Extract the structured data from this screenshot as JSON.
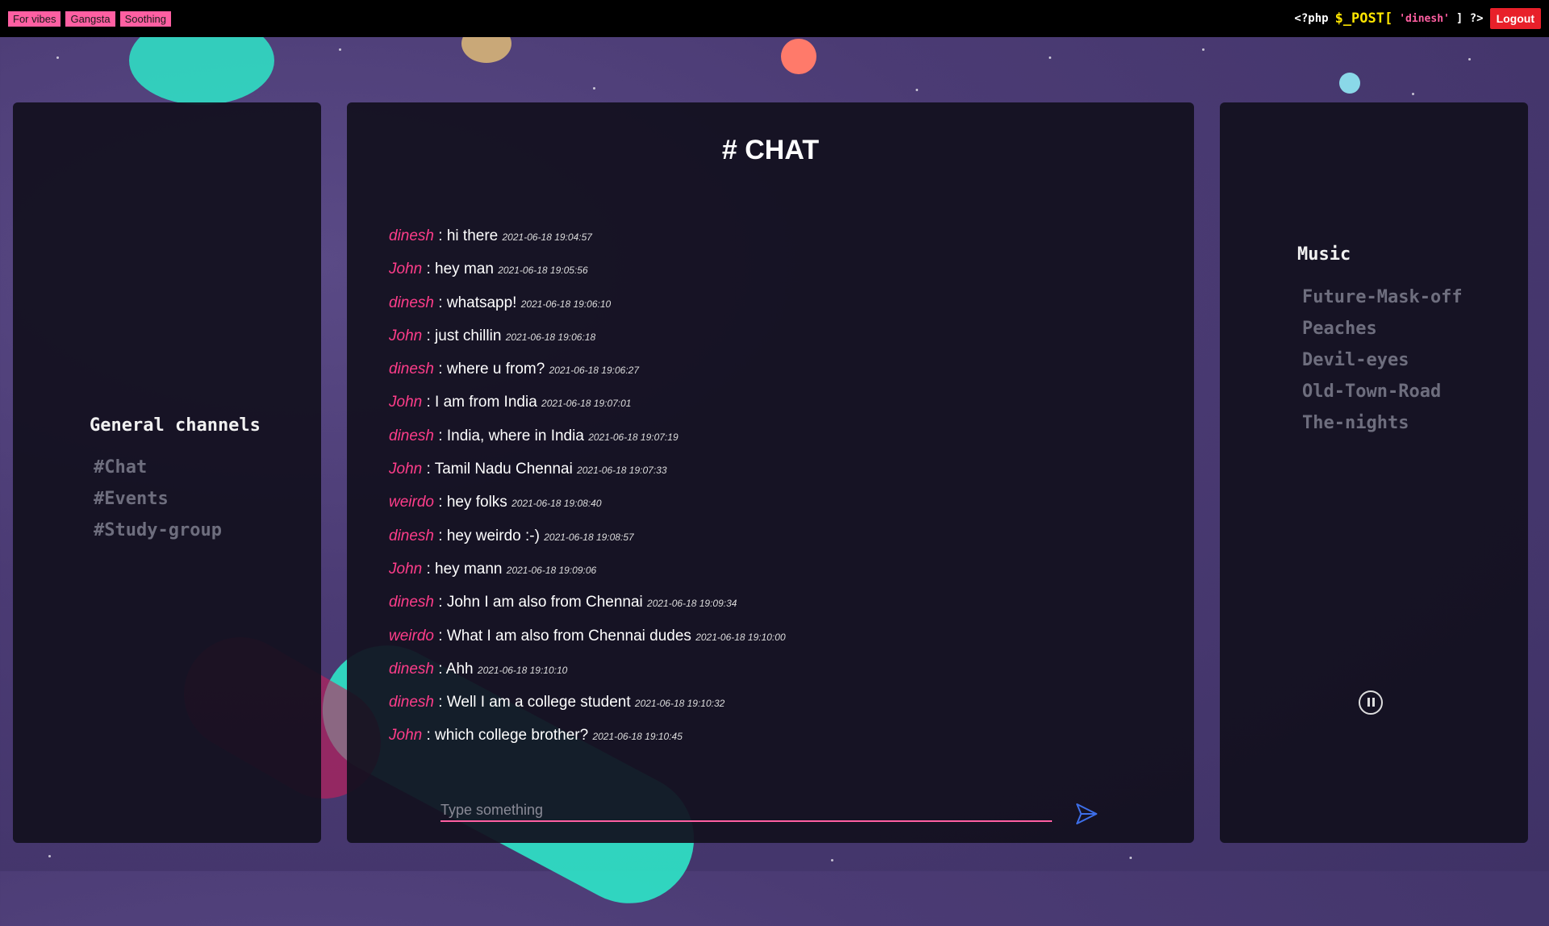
{
  "topbar": {
    "moods": [
      "For vibes",
      "Gangsta",
      "Soothing"
    ],
    "php_open": "<?php",
    "php_var": "$_POST[",
    "php_user": "'dinesh'",
    "php_close": "] ?>",
    "logout_label": "Logout"
  },
  "colors": {
    "accent_pink": "#ff5fa2",
    "logout_red": "#e8202a",
    "highlight_yellow": "#ffe600",
    "background": "#4b3b74",
    "panel": "#12101e"
  },
  "left_panel": {
    "title": "General channels",
    "channels": [
      "#Chat",
      "#Events",
      "#Study-group"
    ]
  },
  "chat": {
    "title": "# CHAT",
    "messages": [
      {
        "user": "dinesh",
        "text": "hi there",
        "time": "2021-06-18 19:04:57"
      },
      {
        "user": "John",
        "text": "hey man",
        "time": "2021-06-18 19:05:56"
      },
      {
        "user": "dinesh",
        "text": "whatsapp!",
        "time": "2021-06-18 19:06:10"
      },
      {
        "user": "John",
        "text": "just chillin",
        "time": "2021-06-18 19:06:18"
      },
      {
        "user": "dinesh",
        "text": "where u from?",
        "time": "2021-06-18 19:06:27"
      },
      {
        "user": "John",
        "text": "I am from India",
        "time": "2021-06-18 19:07:01"
      },
      {
        "user": "dinesh",
        "text": "India, where in India",
        "time": "2021-06-18 19:07:19"
      },
      {
        "user": "John",
        "text": "Tamil Nadu Chennai",
        "time": "2021-06-18 19:07:33"
      },
      {
        "user": "weirdo",
        "text": "hey folks",
        "time": "2021-06-18 19:08:40"
      },
      {
        "user": "dinesh",
        "text": "hey weirdo :-)",
        "time": "2021-06-18 19:08:57"
      },
      {
        "user": "John",
        "text": "hey mann",
        "time": "2021-06-18 19:09:06"
      },
      {
        "user": "dinesh",
        "text": "John I am also from Chennai",
        "time": "2021-06-18 19:09:34"
      },
      {
        "user": "weirdo",
        "text": "What I am also from Chennai dudes",
        "time": "2021-06-18 19:10:00"
      },
      {
        "user": "dinesh",
        "text": "Ahh",
        "time": "2021-06-18 19:10:10"
      },
      {
        "user": "dinesh",
        "text": "Well I am a college student",
        "time": "2021-06-18 19:10:32"
      },
      {
        "user": "John",
        "text": "which college brother?",
        "time": "2021-06-18 19:10:45"
      }
    ],
    "input_placeholder": "Type something",
    "input_value": "",
    "send_icon": "send-icon"
  },
  "right_panel": {
    "title": "Music",
    "songs": [
      "Future-Mask-off",
      "Peaches",
      "Devil-eyes",
      "Old-Town-Road",
      "The-nights"
    ],
    "player_icon": "pause-icon"
  }
}
